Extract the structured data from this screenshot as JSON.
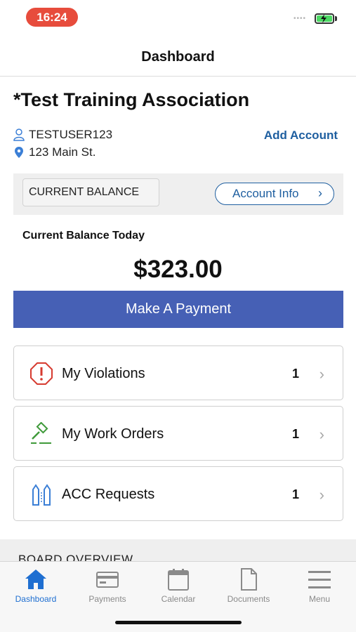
{
  "status_bar": {
    "time": "16:24",
    "signal": "••••"
  },
  "nav": {
    "title": "Dashboard"
  },
  "association": {
    "name": "*Test Training Association"
  },
  "user": {
    "username": "TESTUSER123",
    "address": "123 Main St.",
    "add_account_label": "Add Account"
  },
  "balance": {
    "section_label": "CURRENT BALANCE",
    "account_info_label": "Account Info",
    "today_label": "Current Balance Today",
    "amount": "$323.00",
    "pay_label": "Make A Payment"
  },
  "cards": [
    {
      "label": "My Violations",
      "count": "1",
      "icon": "violation-octagon-icon"
    },
    {
      "label": "My Work Orders",
      "count": "1",
      "icon": "hammer-icon"
    },
    {
      "label": "ACC Requests",
      "count": "1",
      "icon": "acc-request-icon"
    }
  ],
  "board": {
    "label": "BOARD OVERVIEW"
  },
  "tabs": [
    {
      "label": "Dashboard",
      "icon": "home-icon",
      "active": true
    },
    {
      "label": "Payments",
      "icon": "credit-card-icon",
      "active": false
    },
    {
      "label": "Calendar",
      "icon": "calendar-icon",
      "active": false
    },
    {
      "label": "Documents",
      "icon": "document-icon",
      "active": false
    },
    {
      "label": "Menu",
      "icon": "menu-icon",
      "active": false
    }
  ],
  "colors": {
    "accent": "#4660b5",
    "link": "#1f5fa0",
    "active_tab": "#1f6fd1",
    "time_pill": "#e74c3c"
  }
}
